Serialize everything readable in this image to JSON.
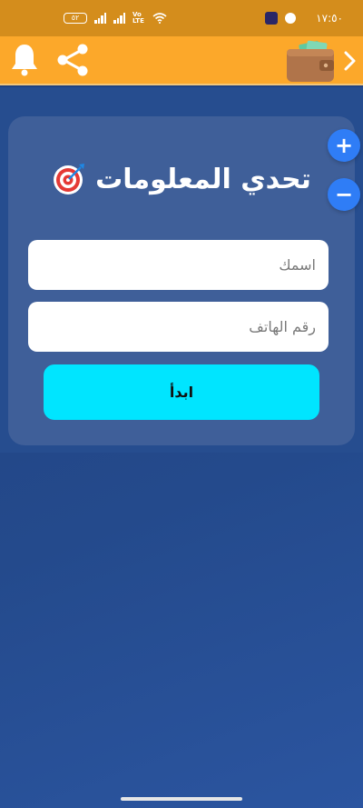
{
  "status_bar": {
    "battery": "٥٢",
    "network": "Vo LTE",
    "time": "١٧:٥٠"
  },
  "toolbar": {
    "icons": [
      "bell-icon",
      "share-icon",
      "wallet-icon",
      "chevron-right-icon"
    ],
    "accent_color": "#fca82a"
  },
  "form": {
    "title": "تحدي المعلومات",
    "name_placeholder": "اسمك",
    "phone_placeholder": "رقم الهاتف",
    "start_label": "ابدأ"
  },
  "zoom": {
    "in_label": "+",
    "out_label": "−"
  }
}
